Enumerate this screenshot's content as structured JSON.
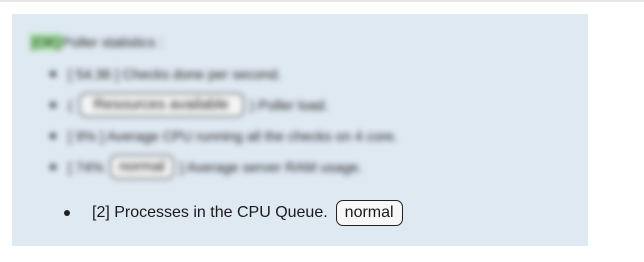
{
  "panel": {
    "title_tag": "[OK]",
    "title": "Poller statistics :",
    "items": [
      {
        "prefix": "[ 54.36 ] Checks done per second.",
        "badge": "",
        "suffix": ""
      },
      {
        "prefix": "(",
        "badge": "Resources available",
        "suffix": ") Poller load."
      },
      {
        "prefix": "[ 9% ] Average CPU running all the checks on 4 core.",
        "badge": "",
        "suffix": ""
      },
      {
        "prefix": "[ 74% ",
        "badge": "normal",
        "suffix": "] Average server RAM usage."
      }
    ],
    "last_item": {
      "text": "[2] Processes in the CPU Queue.",
      "badge": "normal"
    }
  },
  "colors": {
    "panel_bg": "#dfe9f2",
    "ok_tag_bg": "#9fe39a"
  }
}
